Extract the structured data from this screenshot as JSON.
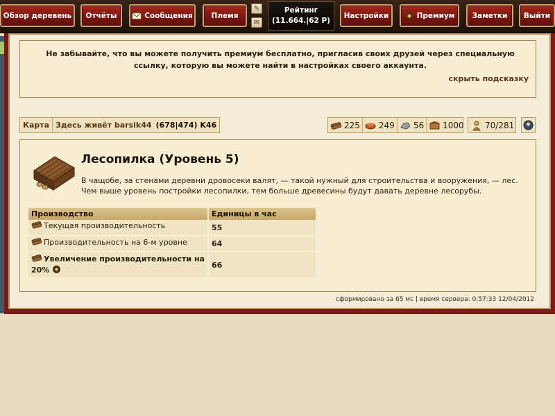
{
  "nav": {
    "overview": "Обзор деревень",
    "reports": "Отчёты",
    "messages": "Сообщения",
    "tribe": "Племя",
    "rating_title": "Рейтинг",
    "rating_value": "(11.664.|62 P)",
    "settings": "Настройки",
    "premium": "Премиум",
    "notes": "Заметки",
    "logout": "Выйти"
  },
  "hint": {
    "text": "Не забывайте, что вы можете получить премиум бесплатно, пригласив своих друзей через специальную ссылку, которую вы можете найти в настройках своего аккаунта.",
    "hide_link": "скрыть подсказку"
  },
  "breadcrumb": {
    "map": "Карта",
    "lives_here": "Здесь живёт barsik44",
    "coords": "(678|474) K46"
  },
  "resources": {
    "wood": "225",
    "clay": "249",
    "iron": "56",
    "storage": "1000",
    "population": "70/281"
  },
  "building": {
    "title": "Лесопилка (Уровень 5)",
    "description": "В чащобе, за стенами деревни дровосеки валят, — такой нужный для строительства и вооружения, — лес. Чем выше уровень постройки лесопилки, тем больше древесины будут давать деревне лесорубы."
  },
  "production": {
    "headers": [
      "Производство",
      "Единицы в час"
    ],
    "rows": [
      {
        "label": "Текущая производительность",
        "value": "55"
      },
      {
        "label": "Производительность на 6-м уровне",
        "value": "64"
      },
      {
        "label": "Увеличение производительности на 20%",
        "value": "66"
      }
    ]
  },
  "footer": "сформировано за 65 мс | время сервера: 0:57:33 12/04/2012",
  "colors": {
    "nav_red": "#8b1a12",
    "frame_red": "#7a1a10",
    "parchment": "#f6edd2",
    "table_header": "#d2b57c"
  }
}
